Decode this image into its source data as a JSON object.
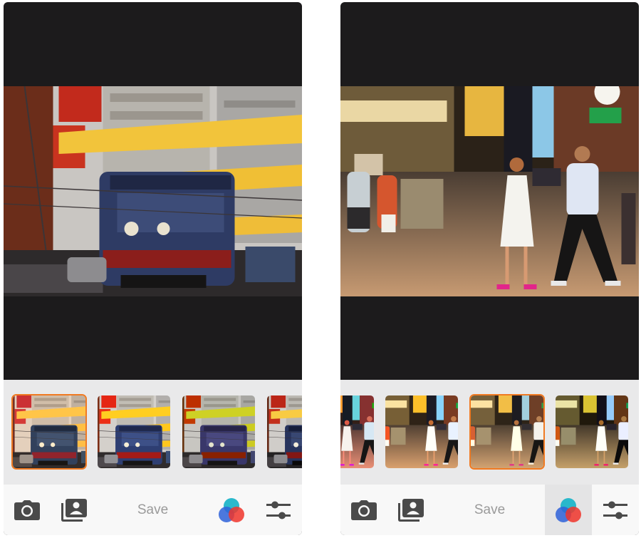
{
  "left_screen": {
    "toolbar": {
      "camera_icon": "camera-icon",
      "library_icon": "photo-library-icon",
      "save_label": "Save",
      "filters_icon": "color-filters-icon",
      "adjust_icon": "sliders-icon"
    },
    "selected_thumbnail": 1
  },
  "right_screen": {
    "toolbar": {
      "camera_icon": "camera-icon",
      "library_icon": "photo-library-icon",
      "save_label": "Save",
      "filters_icon": "color-filters-icon",
      "adjust_icon": "sliders-icon"
    },
    "selected_thumbnail": 3,
    "active_tool": "filters"
  },
  "colors": {
    "accent_selected": "#f07a22",
    "toolbar_icon": "#444444",
    "save_text": "#9a9a9a",
    "dark_background": "#1c1b1c"
  }
}
